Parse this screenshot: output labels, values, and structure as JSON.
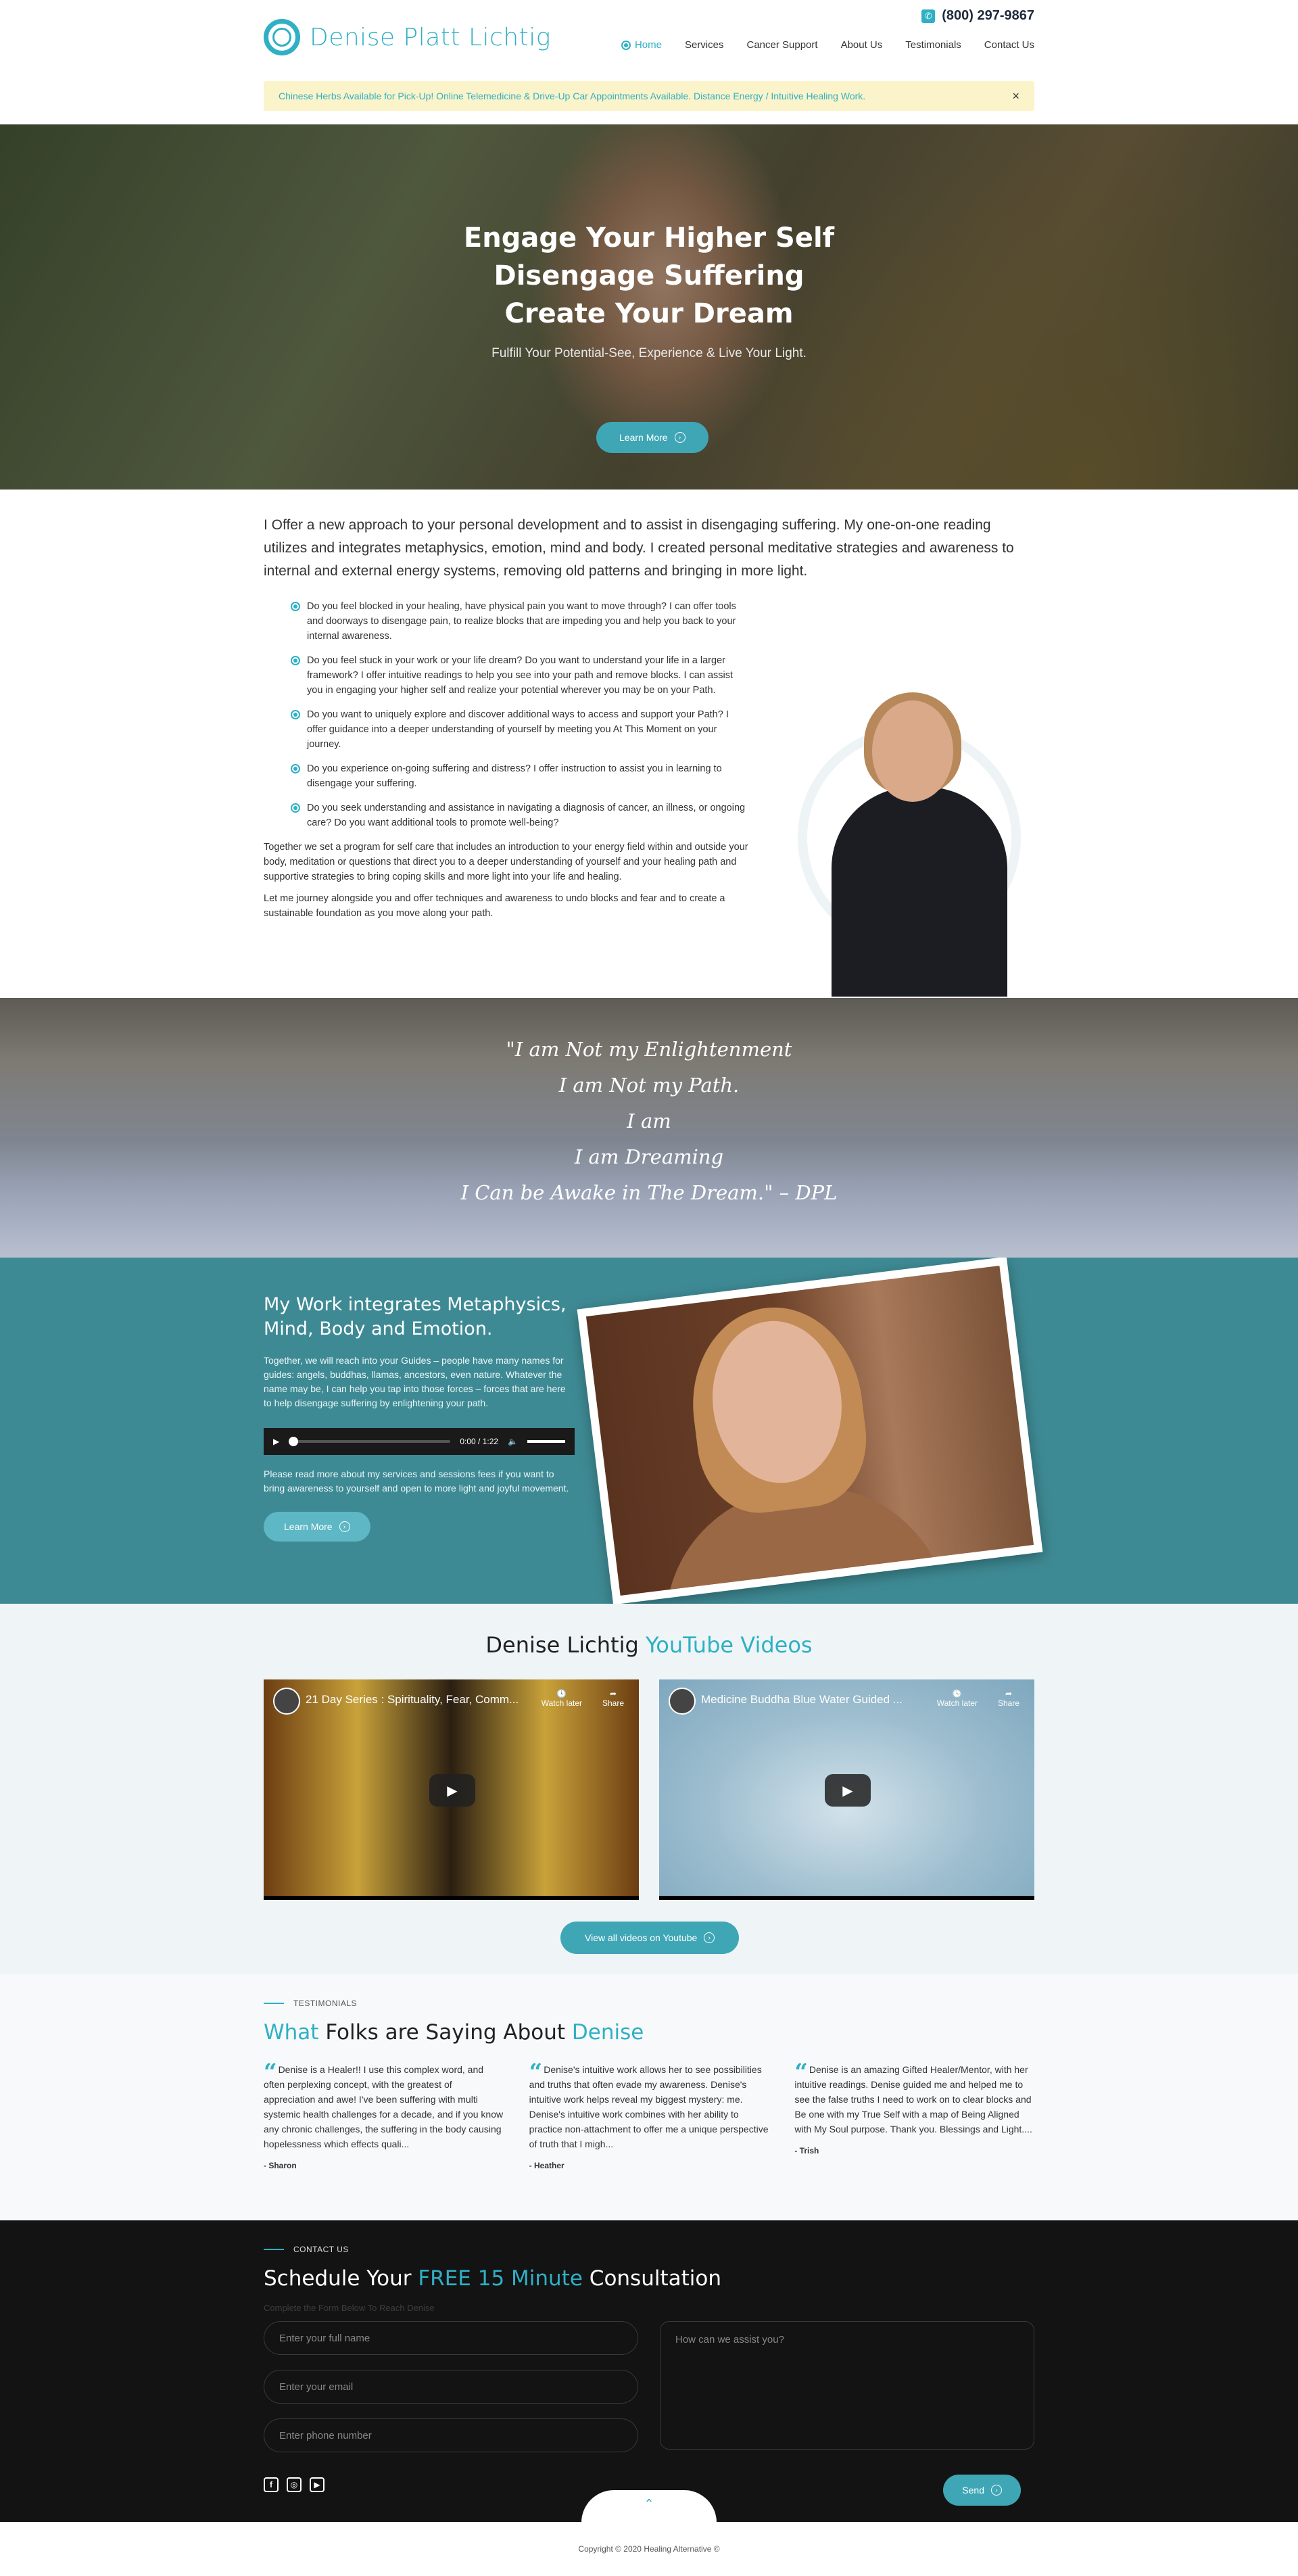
{
  "header": {
    "logo_text": "Denise Platt Lichtig",
    "phone": "(800) 297-9867",
    "nav": [
      "Home",
      "Services",
      "Cancer Support",
      "About Us",
      "Testimonials",
      "Contact Us"
    ],
    "notice": "Chinese Herbs Available for Pick-Up! Online Telemedicine & Drive-Up Car Appointments Available. Distance Energy / Intuitive Healing Work.",
    "notice_close": "×"
  },
  "hero": {
    "line1": "Engage Your Higher Self",
    "line2": "Disengage Suffering",
    "line3": "Create Your Dream",
    "subtitle": "Fulfill Your Potential-See, Experience & Live Your Light.",
    "button": "Learn More"
  },
  "intro": {
    "lead": "I Offer a new approach to your personal development and to assist in disengaging suffering. My one-on-one reading utilizes and integrates metaphysics, emotion, mind and body. I created personal meditative strategies and awareness to internal and external energy systems, removing old patterns and bringing in more light.",
    "bullets": [
      "Do you feel blocked in your healing, have physical pain you want to move through? I can offer tools and doorways to disengage pain, to realize blocks that are impeding you and help you back to your internal awareness.",
      "Do you feel stuck in your work or your life dream? Do you want to understand your life in a larger framework? I offer intuitive readings to help you see into your path and remove blocks. I can assist you in engaging your higher self and realize your potential wherever you may be on your Path.",
      "Do you want to uniquely explore and discover additional ways to access and support your Path? I offer guidance into a deeper understanding of yourself by meeting you At This Moment on your journey.",
      "Do you experience on-going suffering and distress? I offer instruction to assist you in learning to disengage your suffering.",
      "Do you seek understanding and assistance in navigating a diagnosis of cancer, an illness, or ongoing care? Do you want additional tools to promote well-being?"
    ],
    "p1": "Together we set a program for self care that includes an introduction to your energy field within and outside your body, meditation or questions that direct you to a deeper understanding of yourself and your healing path and supportive strategies to bring coping skills and more light into your life and healing.",
    "p2": "Let me journey alongside you and offer techniques and awareness to undo blocks and fear and to create a sustainable foundation as you move along your path."
  },
  "quote": {
    "l1": "\"I am Not my Enlightenment",
    "l2": "I am Not my Path.",
    "l3": "I am",
    "l4": "I am Dreaming",
    "l5": "I Can be Awake in The Dream.\" – DPL"
  },
  "work": {
    "title": "My Work integrates Metaphysics, Mind, Body and Emotion.",
    "p1": "Together, we will reach into your Guides – people have many names for guides: angels, buddhas, llamas, ancestors, even nature. Whatever the name may be, I can help you tap into those forces – forces that are here to help disengage suffering by enlightening your path.",
    "audio_time": "0:00 / 1:22",
    "p2": "Please read more about my services and sessions fees if you want to bring awareness to yourself and open to more light and joyful movement.",
    "button": "Learn More"
  },
  "youtube": {
    "title_a": "Denise Lichtig",
    "title_b": "YouTube Videos",
    "videos": [
      {
        "title": "21 Day Series : Spirituality, Fear, Comm..."
      },
      {
        "title": "Medicine Buddha Blue Water Guided ..."
      }
    ],
    "watch_later": "Watch later",
    "share": "Share",
    "button": "View all videos on Youtube"
  },
  "testimonials": {
    "eyebrow": "TESTIMONIALS",
    "title_a": "What",
    "title_b": "Folks are Saying About",
    "title_c": "Denise",
    "items": [
      {
        "text": "Denise is a Healer!! I use this complex word, and often perplexing concept, with the greatest of appreciation and awe! I've been suffering with multi systemic health challenges for a decade, and if you know any chronic challenges, the suffering in the body causing hopelessness which effects quali...",
        "name": "- Sharon"
      },
      {
        "text": "Denise's intuitive work allows her to see possibilities and truths that often evade my awareness.  Denise's intuitive work helps reveal my biggest mystery: me.  Denise's intuitive work combines with her ability to practice non-attachment to offer me a unique perspective of truth that I migh...",
        "name": "- Heather"
      },
      {
        "text": "Denise is an amazing Gifted Healer/Mentor, with her intuitive readings. Denise guided me and helped me to see the false truths I need to work on to clear blocks and Be one with my True Self with a map of Being Aligned with My Soul purpose. Thank you. Blessings and Light....",
        "name": "- Trish"
      }
    ]
  },
  "contact": {
    "eyebrow": "CONTACT US",
    "title_a": "Schedule Your",
    "title_b": "FREE 15 Minute",
    "title_c": "Consultation",
    "sub": "Complete the Form Below To Reach Denise",
    "name_ph": "Enter your full name",
    "email_ph": "Enter your email",
    "phone_ph": "Enter phone number",
    "message_ph": "How can we assist you?",
    "send": "Send"
  },
  "footer": {
    "copyright": "Copyright © 2020 Healing Alternative ©"
  },
  "colors": {
    "accent": "#2fb0c4",
    "teal_band": "#3e8a94",
    "notice_bg": "#fbf3c9",
    "contact_bg": "#131314"
  }
}
